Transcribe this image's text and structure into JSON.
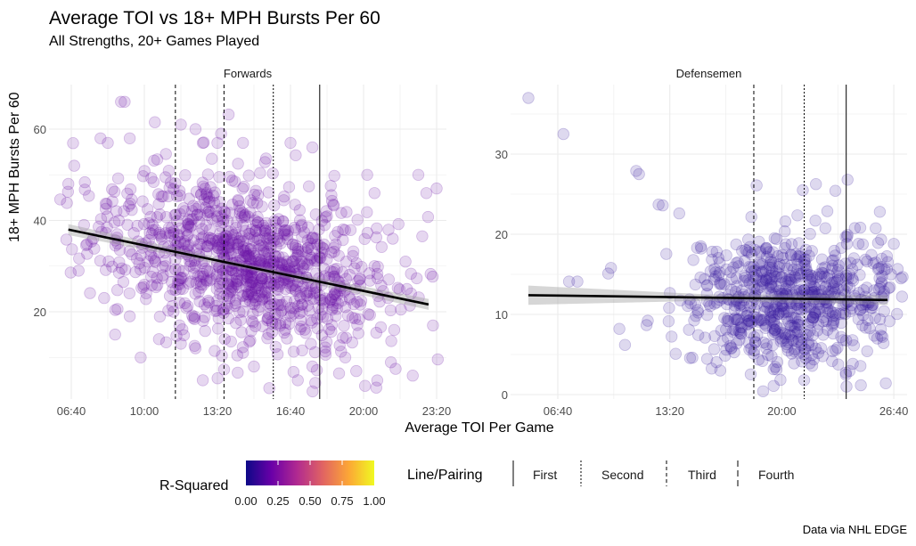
{
  "title": "Average TOI vs 18+ MPH Bursts Per 60",
  "subtitle": "All Strengths, 20+ Games Played",
  "caption": "Data via NHL EDGE",
  "chart_data": {
    "type": "scatter",
    "title": "Average TOI vs 18+ MPH Bursts Per 60",
    "subtitle": "All Strengths, 20+ Games Played",
    "xlabel": "Average TOI Per Game",
    "ylabel": "18+ MPH Bursts Per 60",
    "x_units": "seconds (formatted mm:ss)",
    "grid": true,
    "panels": [
      {
        "name": "Forwards",
        "xlim": [
          360,
          1420
        ],
        "ylim": [
          3,
          69
        ],
        "x_ticks": [
          400,
          600,
          800,
          1000,
          1200,
          1400
        ],
        "x_tick_labels": [
          "06:40",
          "10:00",
          "13:20",
          "16:40",
          "20:00",
          "23:20"
        ],
        "y_ticks": [
          20,
          40,
          60
        ],
        "y_tick_labels": [
          "20",
          "40",
          "60"
        ],
        "r_squared": 0.2,
        "point_color": "#6a13a8",
        "trend": {
          "x": [
            392,
            1378
          ],
          "y": [
            38.0,
            21.6
          ],
          "se_band": [
            1.2,
            0.6,
            1.2
          ]
        },
        "vlines": [
          {
            "line": "Fourth",
            "x": 685,
            "linetype": "dashed"
          },
          {
            "line": "Third",
            "x": 818,
            "linetype": "dashed"
          },
          {
            "line": "Second",
            "x": 953,
            "linetype": "dotted"
          },
          {
            "line": "First",
            "x": 1080,
            "linetype": "solid"
          }
        ],
        "highlight_points": [
          [
            392,
            48
          ],
          [
            420,
            29
          ],
          [
            460,
            36
          ],
          [
            480,
            58
          ],
          [
            500,
            57
          ],
          [
            536,
            66
          ],
          [
            546,
            66
          ],
          [
            560,
            58
          ],
          [
            530,
            40
          ],
          [
            490,
            23
          ],
          [
            520,
            15
          ],
          [
            560,
            19
          ],
          [
            590,
            10
          ],
          [
            640,
            14
          ],
          [
            680,
            20
          ],
          [
            700,
            61
          ],
          [
            740,
            60
          ],
          [
            760,
            57
          ],
          [
            800,
            57
          ],
          [
            810,
            59
          ],
          [
            870,
            57
          ],
          [
            1000,
            57
          ],
          [
            1060,
            56
          ],
          [
            1210,
            50
          ],
          [
            1230,
            46
          ],
          [
            1350,
            50
          ],
          [
            1372,
            46
          ],
          [
            1400,
            47
          ],
          [
            1390,
            17
          ],
          [
            1330,
            24
          ],
          [
            1180,
            7
          ],
          [
            1150,
            10
          ],
          [
            1020,
            5
          ],
          [
            1060,
            8
          ],
          [
            900,
            8
          ],
          [
            760,
            5
          ],
          [
            700,
            13
          ],
          [
            740,
            12
          ],
          [
            820,
            14
          ],
          [
            870,
            11
          ],
          [
            1120,
            25
          ],
          [
            1230,
            30
          ],
          [
            1280,
            36
          ]
        ],
        "cloud": {
          "n": 1050,
          "x_mean": 880,
          "x_sd": 190,
          "y_mean": 31,
          "y_sd": 8.5,
          "slope": -0.0166,
          "seed": 17
        }
      },
      {
        "name": "Defensemen",
        "xlim": [
          160,
          1640
        ],
        "ylim": [
          0,
          36.5
        ],
        "x_ticks": [
          400,
          800,
          1200,
          1600
        ],
        "x_tick_labels": [
          "06:40",
          "13:20",
          "20:00",
          "26:40"
        ],
        "y_ticks": [
          0,
          10,
          20,
          30
        ],
        "y_tick_labels": [
          "0",
          "10",
          "20",
          "30"
        ],
        "r_squared": 0.05,
        "point_color": "#3a1fa0",
        "trend": {
          "x": [
            295,
            1578
          ],
          "y": [
            12.4,
            11.8
          ],
          "se_band": [
            1.2,
            0.4,
            0.6
          ]
        },
        "vlines": [
          {
            "line": "Third",
            "x": 1100,
            "linetype": "dashed"
          },
          {
            "line": "Second",
            "x": 1280,
            "linetype": "dotted"
          },
          {
            "line": "First",
            "x": 1430,
            "linetype": "solid"
          }
        ],
        "highlight_points": [
          [
            295,
            37
          ],
          [
            420,
            32.5
          ],
          [
            440,
            14.1
          ],
          [
            470,
            14.1
          ],
          [
            580,
            15.1
          ],
          [
            590,
            15.8
          ],
          [
            680,
            27.9
          ],
          [
            690,
            27.5
          ],
          [
            620,
            8.2
          ],
          [
            640,
            6.2
          ],
          [
            760,
            23.7
          ],
          [
            775,
            23.6
          ],
          [
            1110,
            26.1
          ],
          [
            1275,
            25.5
          ],
          [
            1435,
            26.8
          ],
          [
            1550,
            22.8
          ],
          [
            1320,
            21.7
          ],
          [
            1600,
            18.8
          ],
          [
            1590,
            15
          ],
          [
            1530,
            13
          ],
          [
            1480,
            10.5
          ],
          [
            1280,
            1.8
          ],
          [
            1300,
            3.9
          ],
          [
            1330,
            5.2
          ],
          [
            1100,
            5.1
          ],
          [
            980,
            3.0
          ],
          [
            960,
            7.3
          ],
          [
            1560,
            7.2
          ]
        ],
        "cloud": {
          "n": 700,
          "x_mean": 1230,
          "x_sd": 190,
          "y_mean": 11.9,
          "y_sd": 4.2,
          "slope": 0.0,
          "seed": 29
        }
      }
    ],
    "legends": {
      "color": {
        "title": "R-Squared",
        "scale": "plasma",
        "range": [
          0,
          1
        ],
        "tick_labels": [
          "0.00",
          "0.25",
          "0.50",
          "0.75",
          "1.00"
        ],
        "stops": [
          "#0d0887",
          "#6a00a8",
          "#b12a90",
          "#e16462",
          "#fca636",
          "#f0f921"
        ]
      },
      "linetype": {
        "title": "Line/Pairing",
        "items": [
          {
            "label": "First",
            "linetype": "solid"
          },
          {
            "label": "Second",
            "linetype": "dotted"
          },
          {
            "label": "Third",
            "linetype": "dashed"
          },
          {
            "label": "Fourth",
            "linetype": "longdash"
          }
        ]
      }
    }
  }
}
